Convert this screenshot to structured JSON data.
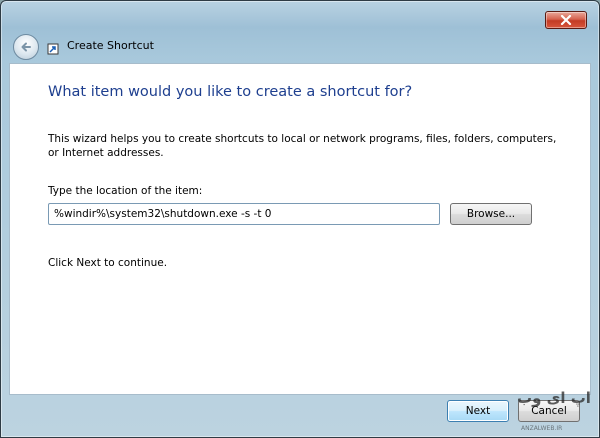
{
  "window": {
    "title": "Create Shortcut"
  },
  "icons": {
    "close": "close-icon",
    "back": "back-arrow-icon",
    "wizard": "shortcut-icon"
  },
  "main": {
    "heading": "What item would you like to create a shortcut for?",
    "description": "This wizard helps you to create shortcuts to local or network programs, files, folders, computers, or Internet addresses.",
    "location_label": "Type the location of the item:",
    "location_value": "%windir%\\system32\\shutdown.exe -s -t 0",
    "browse_label": "Browse...",
    "continue_hint": "Click Next to continue."
  },
  "footer": {
    "next_label": "Next",
    "cancel_label": "Cancel"
  },
  "watermark": {
    "text": "اپ ای وب",
    "sub": "ANZALWEB.IR"
  },
  "colors": {
    "heading": "#1e3f8f",
    "close_button": "#c33b24",
    "next_button_border": "#3c7fb1"
  }
}
